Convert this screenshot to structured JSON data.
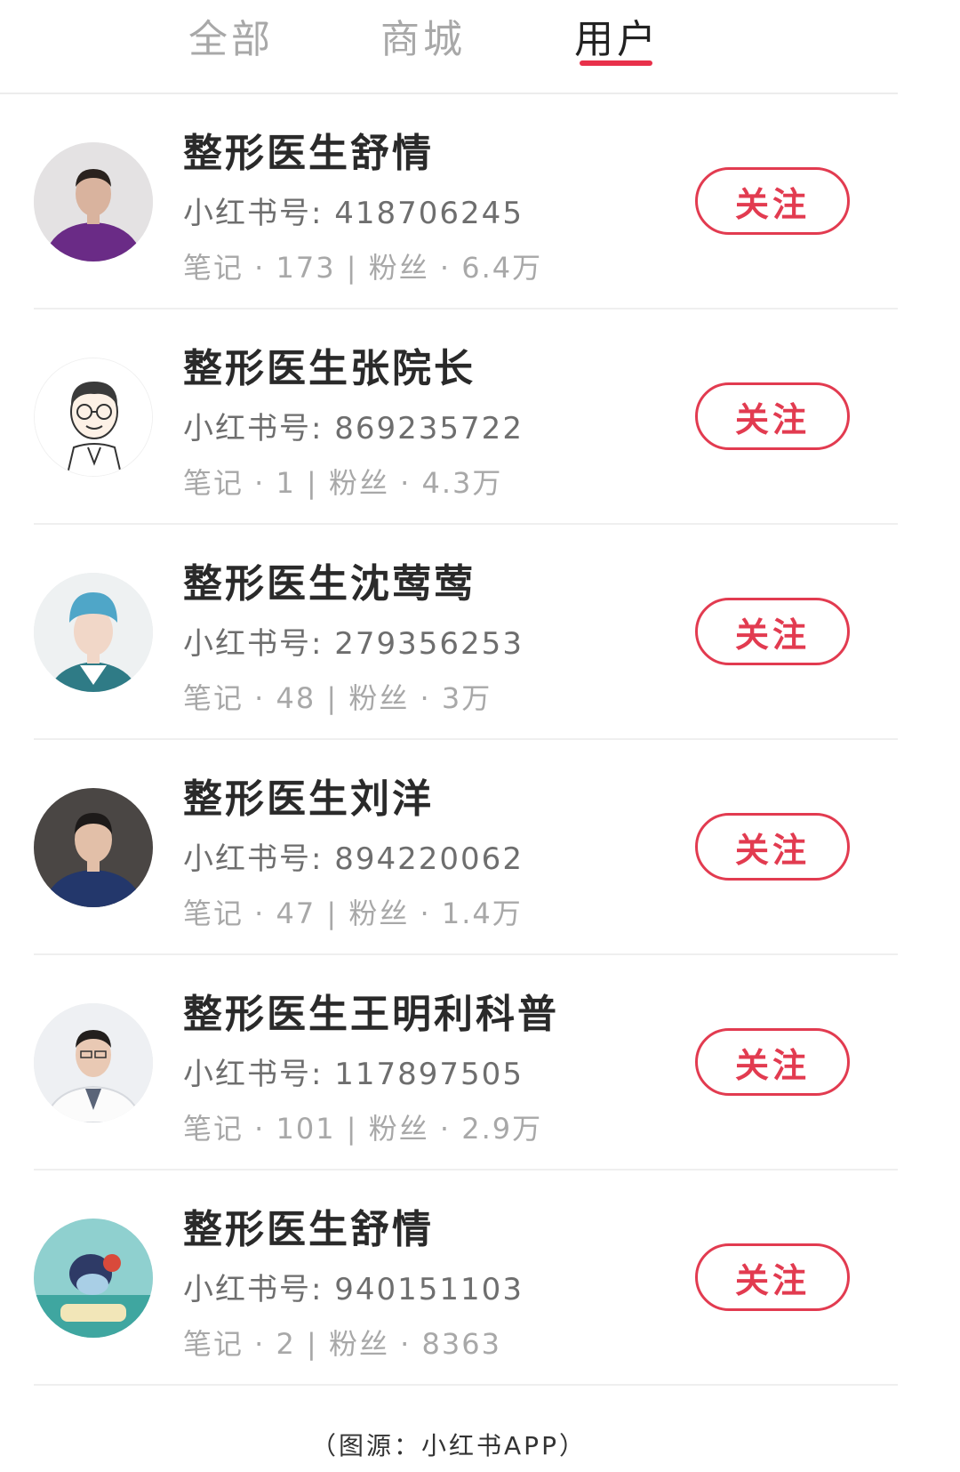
{
  "tabs": [
    {
      "label": "全部",
      "active": false
    },
    {
      "label": "商城",
      "active": false
    },
    {
      "label": "用户",
      "active": true
    }
  ],
  "accent_color": "#e23b50",
  "users": [
    {
      "name": "整形医生舒情",
      "id_line": "小红书号: 418706245",
      "stats": "笔记 · 173 | 粉丝 · 6.4万",
      "follow_label": "关注",
      "avatar": "photo-doctor-purple-scrubs"
    },
    {
      "name": "整形医生张院长",
      "id_line": "小红书号: 869235722",
      "stats": "笔记 · 1 | 粉丝 · 4.3万",
      "follow_label": "关注",
      "avatar": "cartoon-doctor-glasses"
    },
    {
      "name": "整形医生沈莺莺",
      "id_line": "小红书号: 279356253",
      "stats": "笔记 · 48 | 粉丝 · 3万",
      "follow_label": "关注",
      "avatar": "photo-doctor-surgical-cap"
    },
    {
      "name": "整形医生刘洋",
      "id_line": "小红书号: 894220062",
      "stats": "笔记 · 47 | 粉丝 · 1.4万",
      "follow_label": "关注",
      "avatar": "photo-doctor-navy-scrubs"
    },
    {
      "name": "整形医生王明利科普",
      "id_line": "小红书号: 117897505",
      "stats": "笔记 · 101 | 粉丝 · 2.9万",
      "follow_label": "关注",
      "avatar": "photo-doctor-white-coat"
    },
    {
      "name": "整形医生舒情",
      "id_line": "小红书号: 940151103",
      "stats": "笔记 · 2 | 粉丝 · 8363",
      "follow_label": "关注",
      "avatar": "photo-surgery-scene"
    }
  ],
  "caption": "（图源：小红书APP）"
}
